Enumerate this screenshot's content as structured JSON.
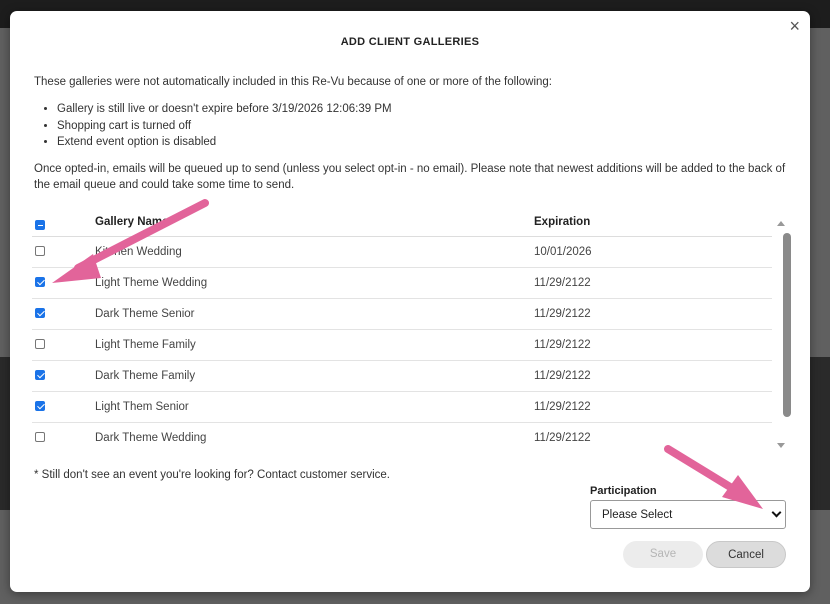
{
  "modal": {
    "title": "ADD CLIENT GALLERIES",
    "close_glyph": "×",
    "intro": "These galleries were not automatically included in this Re-Vu because of one or more of the following:",
    "reasons": [
      "Gallery is still live or doesn't expire before 3/19/2026 12:06:39 PM",
      "Shopping cart is turned off",
      "Extend event option is disabled"
    ],
    "note": "Once opted-in, emails will be queued up to send (unless you select opt-in - no email). Please note that newest additions will be added to the back of the email queue and could take some time to send.",
    "table": {
      "headers": {
        "name": "Gallery Name",
        "expiration": "Expiration"
      },
      "select_all_state": "indeterminate",
      "rows": [
        {
          "name": "Kitchen Wedding",
          "expiration": "10/01/2026",
          "checked": false
        },
        {
          "name": "Light Theme Wedding",
          "expiration": "11/29/2122",
          "checked": true
        },
        {
          "name": "Dark Theme Senior",
          "expiration": "11/29/2122",
          "checked": true
        },
        {
          "name": "Light Theme Family",
          "expiration": "11/29/2122",
          "checked": false
        },
        {
          "name": "Dark Theme Family",
          "expiration": "11/29/2122",
          "checked": true
        },
        {
          "name": "Light Them Senior",
          "expiration": "11/29/2122",
          "checked": true
        },
        {
          "name": "Dark Theme Wedding",
          "expiration": "11/29/2122",
          "checked": false
        }
      ]
    },
    "footnote": "* Still don't see an event you're looking for? Contact customer service.",
    "participation": {
      "label": "Participation",
      "selected": "Please Select"
    },
    "buttons": {
      "save": "Save",
      "cancel": "Cancel"
    }
  },
  "colors": {
    "checkbox_accent": "#1a73e8",
    "annotation_arrow": "#e2649a"
  },
  "icons": [
    "close-icon",
    "chevron-down-icon",
    "scroll-up-icon",
    "scroll-down-icon",
    "annotation-arrow-icon"
  ]
}
